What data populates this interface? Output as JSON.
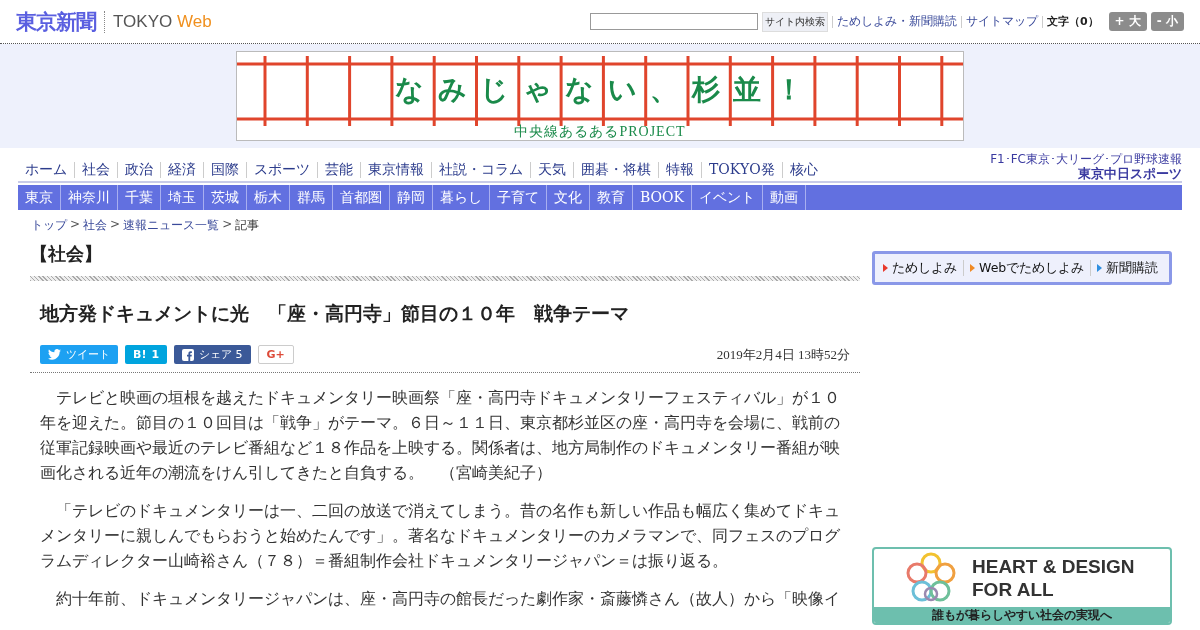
{
  "header": {
    "logo": "東京新聞",
    "brand_1": "TOKYO",
    "brand_2": "Web",
    "search_button": "サイト内検索",
    "links": [
      "ためしよみ・新聞購読",
      "サイトマップ"
    ],
    "font_size_label": "文字（0）",
    "font_buttons": [
      "+ 大",
      "- 小"
    ]
  },
  "banner": {
    "title": "なみじゃない、杉並！",
    "subtitle": "中央線あるあるPROJECT"
  },
  "main_nav": [
    "ホーム",
    "社会",
    "政治",
    "経済",
    "国際",
    "スポーツ",
    "芸能",
    "東京情報",
    "社説・コラム",
    "天気",
    "囲碁・将棋",
    "特報",
    "TOKYO発",
    "核心"
  ],
  "sports_link": {
    "caption": "F1･FC東京･大リーグ･プロ野球速報",
    "logo": "東京中日スポーツ"
  },
  "region_nav": [
    "東京",
    "神奈川",
    "千葉",
    "埼玉",
    "茨城",
    "栃木",
    "群馬",
    "首都圏",
    "静岡",
    "暮らし",
    "子育て",
    "文化",
    "教育",
    "BOOK",
    "イベント",
    "動画"
  ],
  "breadcrumb": [
    {
      "label": "トップ",
      "link": true
    },
    {
      "label": "社会",
      "link": true
    },
    {
      "label": "速報ニュース一覧",
      "link": true
    },
    {
      "label": "記事",
      "link": false
    }
  ],
  "breadcrumb_separators": [
    ">",
    ">",
    ">"
  ],
  "section": "【社会】",
  "article": {
    "title": "地方発ドキュメントに光　「座・高円寺」節目の１０年　戦争テーマ",
    "share": [
      {
        "kind": "tweet",
        "label": "ツイート"
      },
      {
        "kind": "hatena",
        "label": "B!",
        "count": "1"
      },
      {
        "kind": "facebook",
        "label": "シェア 5"
      },
      {
        "kind": "gplus",
        "label": "G+"
      }
    ],
    "date": "2019年2月4日 13時52分",
    "paragraphs": [
      "　テレビと映画の垣根を越えたドキュメンタリー映画祭「座・高円寺ドキュメンタリーフェスティバル」が１０年を迎えた。節目の１０回目は「戦争」がテーマ。６日～１１日、東京都杉並区の座・高円寺を会場に、戦前の従軍記録映画や最近のテレビ番組など１８作品を上映する。関係者は、地方局制作のドキュメンタリー番組が映画化される近年の潮流をけん引してきたと自負する。　（宮崎美紀子）",
      "　「テレビのドキュメンタリーは一、二回の放送で消えてしまう。昔の名作も新しい作品も幅広く集めてドキュメンタリーに親しんでもらおうと始めたんです」。著名なドキュメンタリーのカメラマンで、同フェスのプログラムディレクター山崎裕さん（７８）＝番組制作会社ドキュメンタリージャパン＝は振り返る。",
      "　約十年前、ドキュメンタリージャパンは、座・高円寺の館長だった劇作家・斎藤憐さん（故人）から「映像イ"
    ]
  },
  "sidebar": {
    "links": [
      {
        "label": "ためしよみ",
        "color": "#e8392c"
      },
      {
        "label": "Webでためしよみ",
        "color": "#f08a24"
      },
      {
        "label": "新聞購読",
        "color": "#2f8fe0"
      }
    ],
    "ad": {
      "title_1": "HEART & DESIGN",
      "title_2": "FOR ALL",
      "caption": "誰もが暮らしやすい社会の実現へ"
    }
  }
}
